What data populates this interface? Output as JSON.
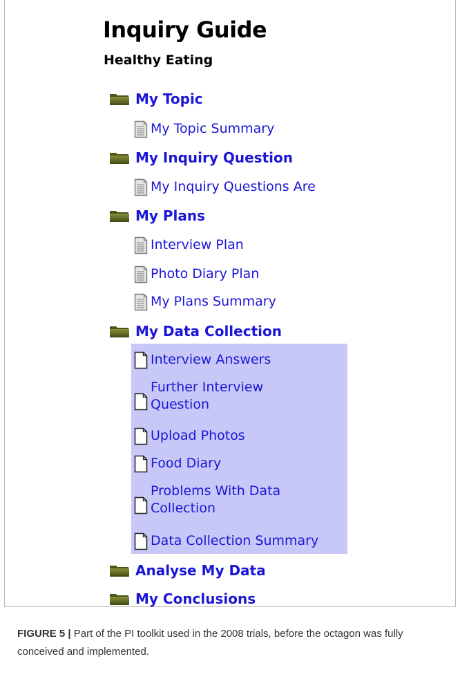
{
  "header": {
    "title": "Inquiry Guide",
    "subtitle": "Healthy Eating"
  },
  "tree": {
    "folders": [
      {
        "label": "My Topic",
        "pages": [
          "My Topic Summary"
        ]
      },
      {
        "label": "My Inquiry Question",
        "pages": [
          "My Inquiry Questions Are"
        ]
      },
      {
        "label": "My Plans",
        "pages": [
          "Interview Plan",
          "Photo Diary Plan",
          "My Plans Summary"
        ]
      },
      {
        "label": "My Data Collection",
        "pages": [
          "Interview Answers",
          "Further Interview",
          "Question",
          "Upload Photos",
          "Food Diary",
          "Problems With Data",
          "Collection",
          "Data Collection Summary"
        ]
      },
      {
        "label": "Analyse My Data",
        "pages": []
      },
      {
        "label": "My Conclusions",
        "pages": []
      }
    ]
  },
  "colors": {
    "link": "#1a16d6",
    "highlight": "#c7c8f7",
    "folder_icon": "olive-green"
  },
  "icons": {
    "folder": "folder-icon",
    "document_filled": "document-lines-icon",
    "document_blank": "blank-page-icon"
  },
  "caption": {
    "label": "FIGURE 5",
    "separator": "|",
    "text": " Part of the PI toolkit used in the 2008 trials, before the octagon was fully conceived and implemented."
  }
}
